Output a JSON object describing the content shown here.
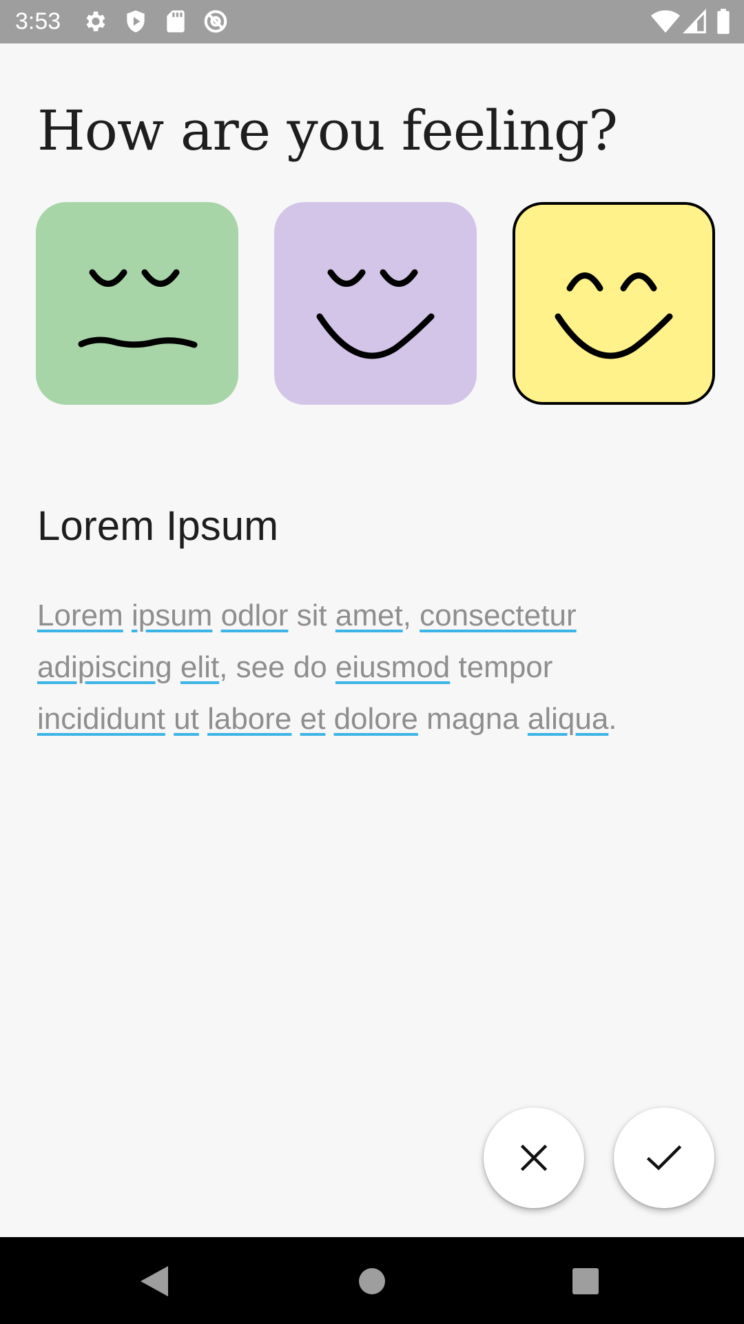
{
  "status_bar": {
    "time": "3:53",
    "icons_left": [
      "settings-icon",
      "play-protect-icon",
      "sd-card-icon",
      "at-sign-icon"
    ],
    "icons_right": [
      "wifi-icon",
      "cell-signal-icon",
      "battery-icon"
    ]
  },
  "title": "How are you feeling?",
  "moods": [
    {
      "id": "meh",
      "icon": "meh-face-icon",
      "color": "#a8d5a8",
      "selected": false
    },
    {
      "id": "calm",
      "icon": "calm-smile-face-icon",
      "color": "#d3c5e8",
      "selected": false
    },
    {
      "id": "happy",
      "icon": "happy-face-icon",
      "color": "#fff28a",
      "selected": true
    }
  ],
  "section": {
    "heading": "Lorem Ipsum",
    "body": {
      "l1w1": "Lorem",
      "l1w2": "ipsum",
      "l1w3": "odlor",
      "l1t1": " sit ",
      "l1w4": "amet",
      "l1t2": ", ",
      "l1w5": "consectetur",
      "l2w1": "adipiscing",
      "l2w2": "elit",
      "l2t1": ", see do ",
      "l2w3": "eiusmod",
      "l2t2": " tempor",
      "l3w1": "incididunt",
      "l3w2": "ut",
      "l3w3": "labore",
      "l3w4": "et",
      "l3w5": "dolore",
      "l3t1": " magna ",
      "l3w6": "aliqua",
      "l3t2": "."
    },
    "underline_color": "#3bb4e6"
  },
  "actions": {
    "cancel_icon": "close-icon",
    "confirm_icon": "checkmark-icon"
  },
  "nav_bar": {
    "buttons": [
      "back-icon",
      "home-icon",
      "recents-icon"
    ]
  }
}
